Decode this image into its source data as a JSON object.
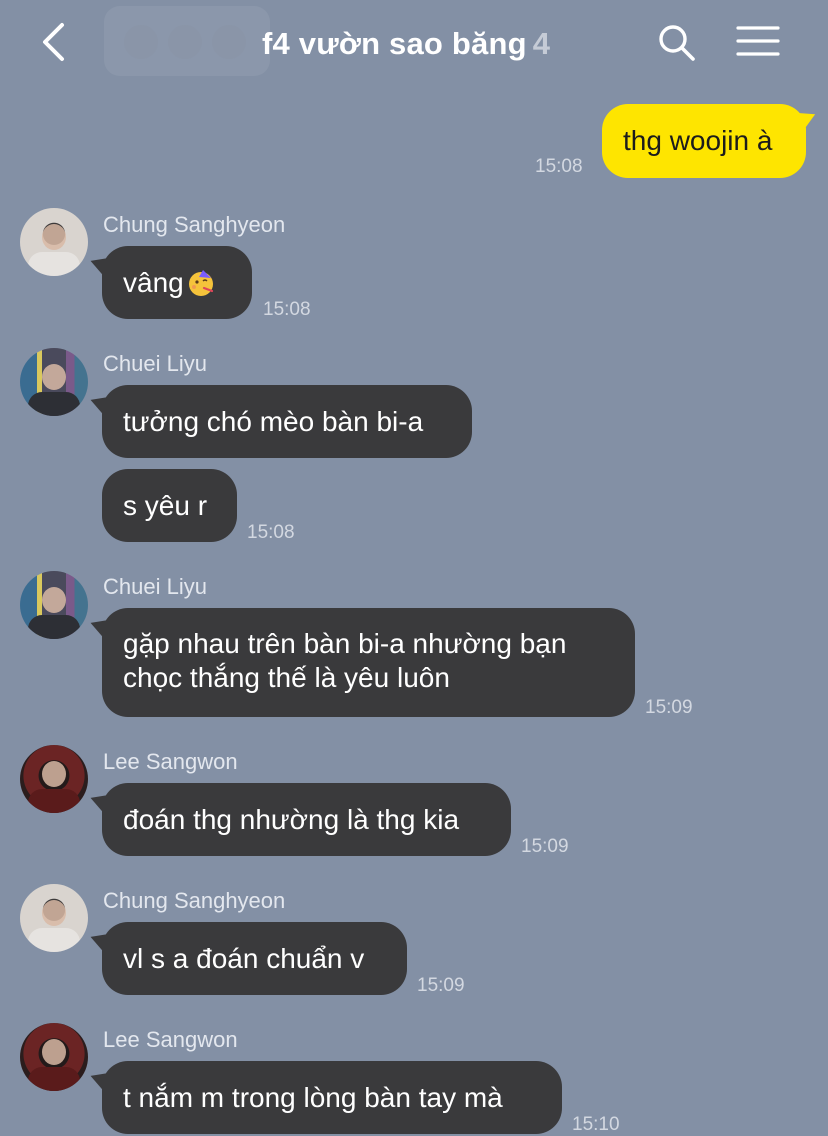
{
  "header": {
    "title": "f4 vườn sao băng",
    "member_count": "4",
    "icons": {
      "back": "chevron-left-icon",
      "search": "search-icon",
      "menu": "hamburger-menu-icon"
    }
  },
  "colors": {
    "background": "#8390a5",
    "my_bubble": "#fee500",
    "other_bubble": "#3a3a3c"
  },
  "messages": [
    {
      "sender": "",
      "mine": true,
      "lines": [
        "thg woojin à"
      ],
      "time": "15:08"
    },
    {
      "sender": "Chung Sanghyeon",
      "mine": false,
      "lines": [
        "vâng"
      ],
      "emoji": "partying-face-emoji",
      "time": "15:08"
    },
    {
      "sender": "Chuei Liyu",
      "mine": false,
      "lines": [
        "tưởng chó mèo bàn bi-a"
      ],
      "time": ""
    },
    {
      "sender": "Chuei Liyu",
      "mine": false,
      "lines": [
        "s yêu r"
      ],
      "time": "15:08"
    },
    {
      "sender": "Chuei Liyu",
      "mine": false,
      "lines": [
        "gặp nhau trên bàn bi-a nhường bạn",
        "chọc thắng thế là yêu luôn"
      ],
      "time": "15:09"
    },
    {
      "sender": "Lee Sangwon",
      "mine": false,
      "lines": [
        "đoán thg nhường là thg kia"
      ],
      "time": "15:09"
    },
    {
      "sender": "Chung Sanghyeon",
      "mine": false,
      "lines": [
        "vl s a đoán chuẩn v"
      ],
      "time": "15:09"
    },
    {
      "sender": "Lee Sangwon",
      "mine": false,
      "lines": [
        "t nắm m trong lòng bàn tay mà"
      ],
      "time": "15:10"
    }
  ]
}
